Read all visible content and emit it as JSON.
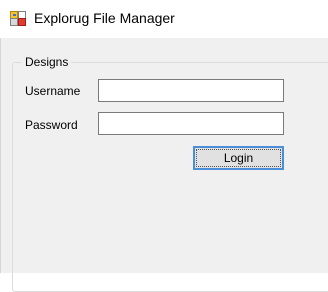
{
  "window": {
    "title": "Explorug File Manager",
    "icon": "app-window-icon"
  },
  "group": {
    "label": "Designs"
  },
  "form": {
    "username_label": "Username",
    "username_value": "",
    "password_label": "Password",
    "password_value": "",
    "login_label": "Login"
  },
  "colors": {
    "accent": "#4a8fd8",
    "button_bg": "#e1e1e1",
    "client_bg": "#f0f0f0"
  }
}
